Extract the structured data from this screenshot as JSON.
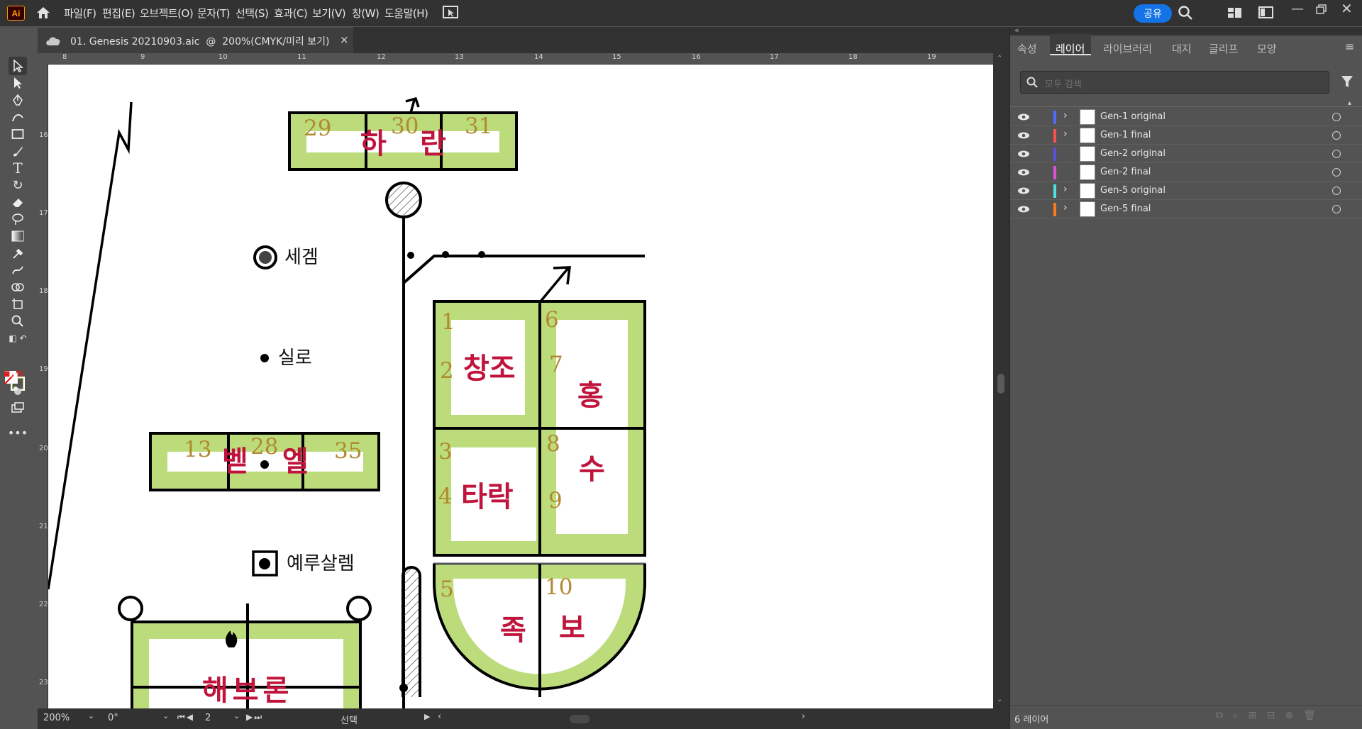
{
  "app": {
    "logo": "Ai"
  },
  "menu": [
    "파일(F)",
    "편집(E)",
    "오브젝트(O)",
    "문자(T)",
    "선택(S)",
    "효과(C)",
    "보기(V)",
    "창(W)",
    "도움말(H)"
  ],
  "share_label": "공유",
  "document_tab": {
    "title": "01. Genesis 20210903.aic  @  200%(CMYK/미리 보기)",
    "close": "×"
  },
  "ruler": {
    "h_ticks": [
      "8",
      "9",
      "10",
      "11",
      "12",
      "13",
      "14",
      "15",
      "16",
      "17",
      "18",
      "19"
    ],
    "v_ticks": [
      "16",
      "17",
      "18",
      "19",
      "20",
      "21",
      "22",
      "23"
    ]
  },
  "artwork": {
    "numbers": [
      "29",
      "30",
      "31",
      "1",
      "2",
      "6",
      "7",
      "3",
      "4",
      "8",
      "9",
      "5",
      "10",
      "13",
      "28",
      "35"
    ],
    "korean": {
      "haran_1": "하",
      "haran_2": "란",
      "changjo": "창조",
      "hong": "홍",
      "tarak": "타락",
      "su": "수",
      "jok": "족",
      "bo": "보",
      "bel_1": "벧",
      "bel_2": "엘",
      "hebron": "해브론"
    },
    "labels": {
      "segem": "세겜",
      "silo": "실로",
      "jerusalem": "예루살렘"
    }
  },
  "status": {
    "zoom": "200%",
    "rotation": "0°",
    "artboard": "2",
    "mode": "선택"
  },
  "panel": {
    "tabs": [
      "속성",
      "레이어",
      "라이브러리",
      "대지",
      "글리프",
      "모양"
    ],
    "active_tab": "레이어",
    "search_placeholder": "모두 검색",
    "layers": [
      {
        "name": "Gen-1 original",
        "color": "#4f6cff",
        "expand": "›"
      },
      {
        "name": "Gen-1 final",
        "color": "#ff4f4f",
        "expand": "›"
      },
      {
        "name": "Gen-2 original",
        "color": "#5a4fe0",
        "expand": ""
      },
      {
        "name": "Gen-2 final",
        "color": "#e04fd9",
        "expand": ""
      },
      {
        "name": "Gen-5 original",
        "color": "#4fe0e0",
        "expand": "›"
      },
      {
        "name": "Gen-5 final",
        "color": "#ff7a1a",
        "expand": "›"
      }
    ],
    "layer_count": "6 레이어"
  }
}
